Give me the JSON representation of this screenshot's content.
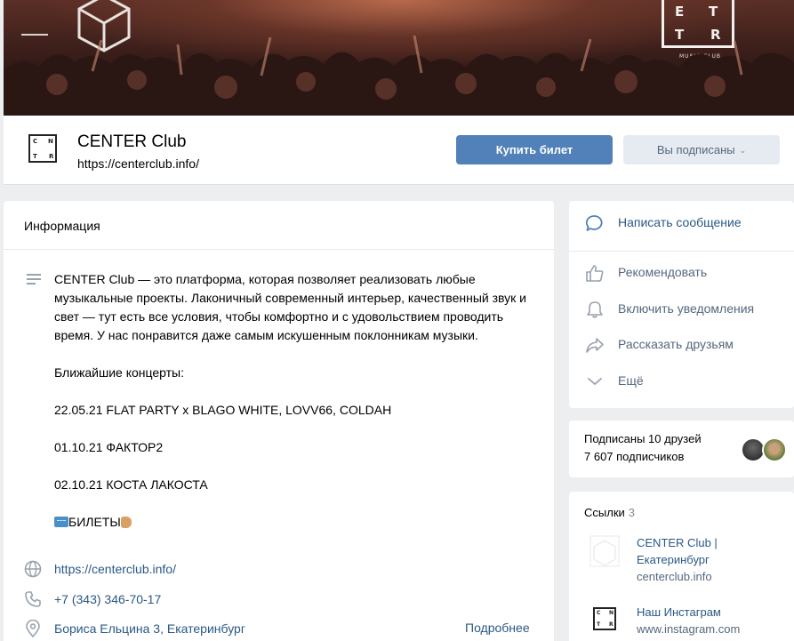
{
  "cover": {
    "logo_letters": [
      "C",
      "E",
      "N",
      "T",
      "E",
      "R"
    ],
    "logo_subtitle": "MUSIC CLUB"
  },
  "header": {
    "name": "CENTER Club",
    "url": "https://centerclub.info/",
    "buy_button": "Купить билет",
    "subscribed_button": "Вы подписаны"
  },
  "info": {
    "title": "Информация",
    "description": "CENTER Club — это платформа, которая позволяет реализовать любые музыкальные проекты. Лаконичный современный интерьер, качественный звук и свет — тут есть все условия, чтобы комфортно и с удовольствием проводить время. У нас понравится даже самым искушенным поклонникам музыки.",
    "concerts_heading": "Ближайшие концерты:",
    "concerts": [
      "22.05.21 FLAT PARTY x BLAGO WHITE, LOVV66, COLDAH",
      "01.10.21 ФАКТОР2",
      "02.10.21 КОСТА ЛАКОСТА"
    ],
    "tickets_label": "БИЛЕТЫ",
    "website": "https://centerclub.info/",
    "phone": "+7 (343) 346-70-17",
    "address": "Бориса Ельцина 3, Екатеринбург",
    "more": "Подробнее"
  },
  "actions": [
    {
      "label": "Написать сообщение",
      "icon": "message-icon"
    },
    {
      "label": "Рекомендовать",
      "icon": "thumbs-up-icon"
    },
    {
      "label": "Включить уведомления",
      "icon": "bell-icon"
    },
    {
      "label": "Рассказать друзьям",
      "icon": "share-icon"
    },
    {
      "label": "Ещё",
      "icon": "chevron-down-icon"
    }
  ],
  "friends": {
    "line1": "Подписаны 10 друзей",
    "line2": "7 607 подписчиков"
  },
  "links": {
    "title": "Ссылки",
    "count": "3",
    "items": [
      {
        "title": "CENTER Club | Екатеринбург",
        "domain": "centerclub.info"
      },
      {
        "title": "Наш Инстаграм",
        "domain": "www.instagram.com"
      }
    ]
  },
  "colors": {
    "accent": "#5181b8",
    "link": "#2a5885",
    "muted": "#55677d",
    "page_bg": "#edeef0"
  }
}
